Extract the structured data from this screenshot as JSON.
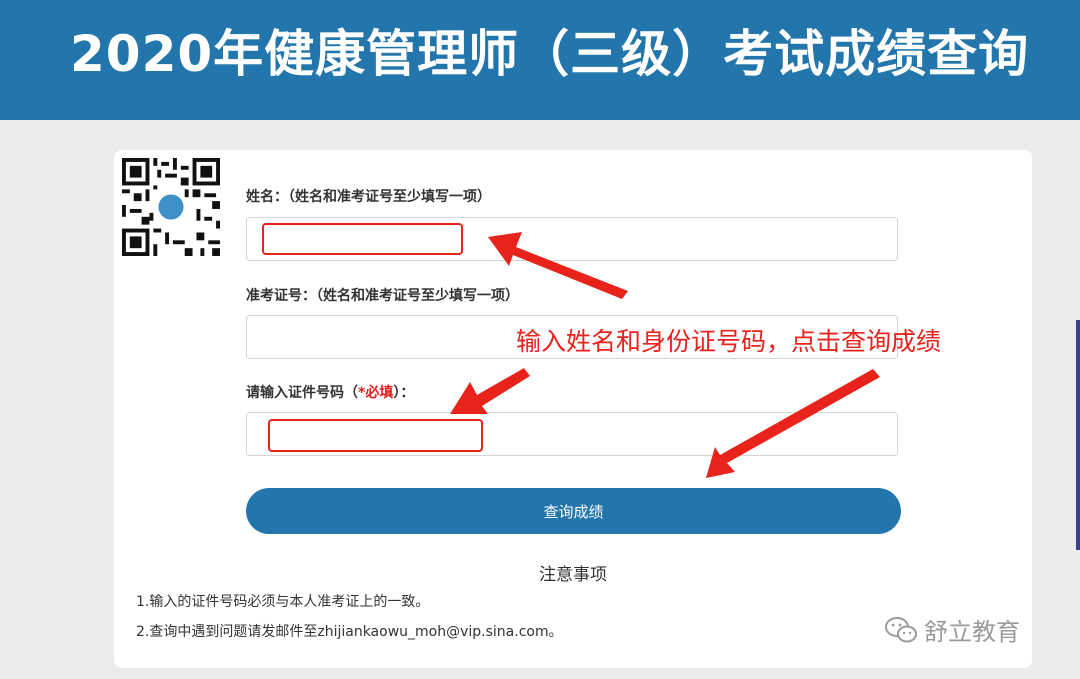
{
  "header": {
    "title": "2020年健康管理师（三级）考试成绩查询"
  },
  "form": {
    "name_label": "姓名：（姓名和准考证号至少填写一项）",
    "name_value": "",
    "exam_no_label": "准考证号：（姓名和准考证号至少填写一项）",
    "exam_no_value": "",
    "id_label_prefix": "请输入证件号码（",
    "id_label_required": "*必填",
    "id_label_suffix": "）：",
    "id_value": "",
    "submit_label": "查询成绩"
  },
  "notice": {
    "title": "注意事项",
    "items": [
      "1.输入的证件号码必须与本人准考证上的一致。",
      "2.查询中遇到问题请发邮件至zhijiankaowu_moh@vip.sina.com。"
    ]
  },
  "annotation": {
    "text": "输入姓名和身份证号码，点击查询成绩"
  },
  "watermark": {
    "text": "舒立教育",
    "icon": "wechat-icon"
  },
  "colors": {
    "brand": "#2276ab",
    "annotation": "#e8231b",
    "background": "#ececec"
  }
}
